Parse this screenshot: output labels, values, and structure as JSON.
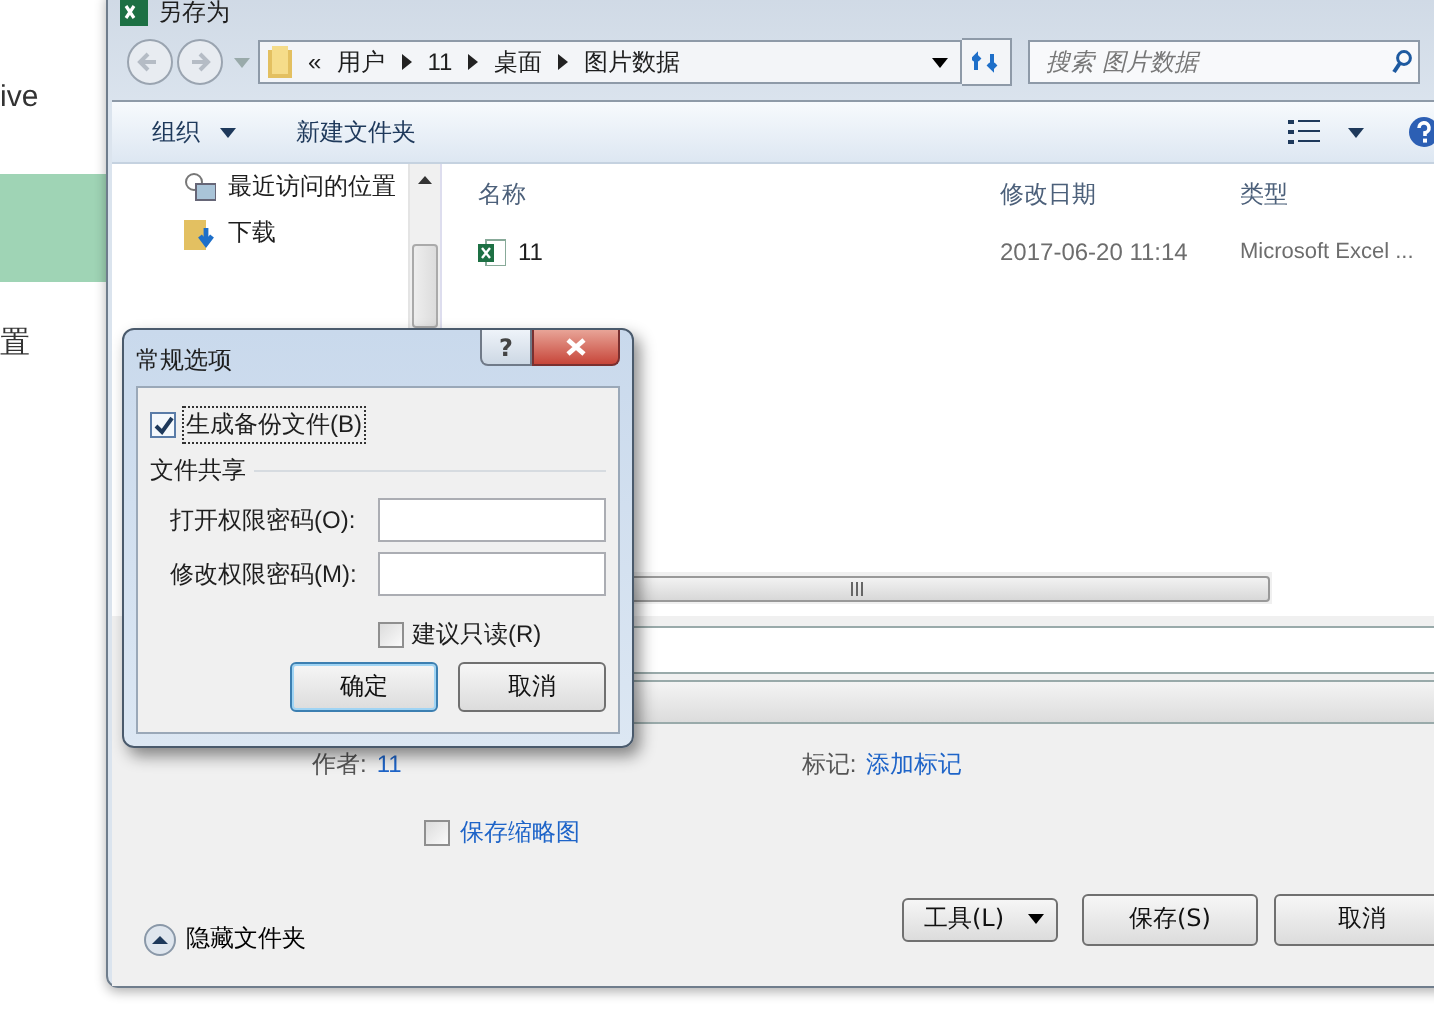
{
  "background_page": {
    "texts": [
      "ive",
      "置"
    ],
    "highlight": true
  },
  "save_as_window": {
    "title": "另存为",
    "breadcrumb": {
      "prefix": "«",
      "parts": [
        "用户",
        "11",
        "桌面",
        "图片数据"
      ]
    },
    "search": {
      "placeholder": "搜索 图片数据"
    },
    "toolbar": {
      "organize": "组织",
      "new_folder": "新建文件夹"
    },
    "nav_items": [
      {
        "label": "最近访问的位置",
        "kind": "recent"
      },
      {
        "label": "下载",
        "kind": "download"
      }
    ],
    "table": {
      "columns": [
        "名称",
        "修改日期",
        "类型"
      ],
      "rows": [
        {
          "name": "11",
          "modified": "2017-06-20 11:14",
          "type": "Microsoft Excel ..."
        }
      ]
    },
    "author": {
      "label": "作者:",
      "value": "11"
    },
    "tags": {
      "label": "标记:",
      "value": "添加标记"
    },
    "thumbnail": {
      "label": "保存缩略图",
      "checked": false
    },
    "hide_folders": "隐藏文件夹",
    "buttons": {
      "tools": "工具(L)",
      "save": "保存(S)",
      "cancel": "取消"
    }
  },
  "options_dialog": {
    "title": "常规选项",
    "help": "?",
    "backup": {
      "label": "生成备份文件(B)",
      "checked": true
    },
    "group": "文件共享",
    "fields": [
      {
        "label": "打开权限密码(O):"
      },
      {
        "label": "修改权限密码(M):"
      }
    ],
    "read_only": {
      "label": "建议只读(R)",
      "checked": false
    },
    "buttons": [
      "确定",
      "取消"
    ]
  }
}
